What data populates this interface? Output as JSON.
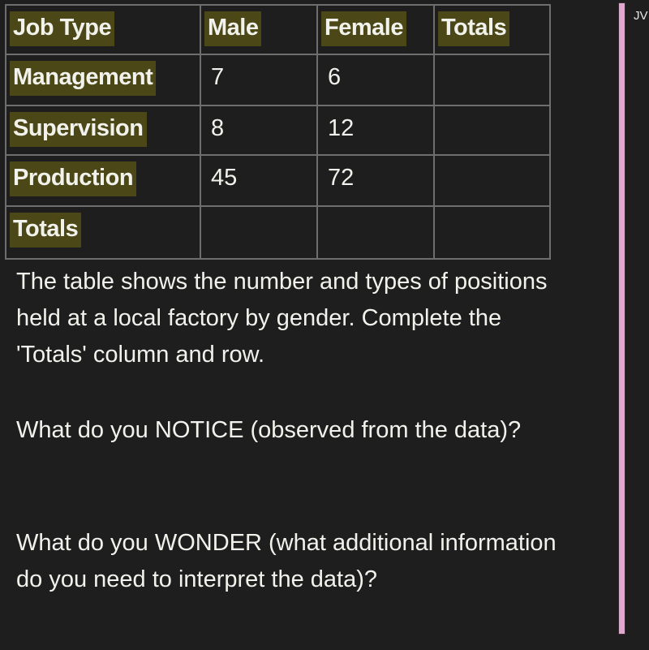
{
  "table": {
    "headers": [
      "Job Type",
      "Male",
      "Female",
      "Totals"
    ],
    "rows": [
      {
        "label": "Management",
        "male": "7",
        "female": "6",
        "total": ""
      },
      {
        "label": "Supervision",
        "male": "8",
        "female": "12",
        "total": ""
      },
      {
        "label": "Production",
        "male": "45",
        "female": "72",
        "total": ""
      },
      {
        "label": "Totals",
        "male": "",
        "female": "",
        "total": ""
      }
    ]
  },
  "paragraphs": {
    "intro": "The table shows the number and types of positions held at a local factory by gender. Complete the 'Totals' column and row.",
    "notice": "What do you NOTICE (observed from the data)?",
    "wonder": "What do you WONDER (what additional information do you need to interpret the data)?"
  },
  "sidebar": {
    "label": "JV"
  },
  "colors": {
    "background": "#1e1e1e",
    "highlight": "#4b4717",
    "grid": "#6e6e6e",
    "sidebar_bar": "#e2a7cf"
  }
}
